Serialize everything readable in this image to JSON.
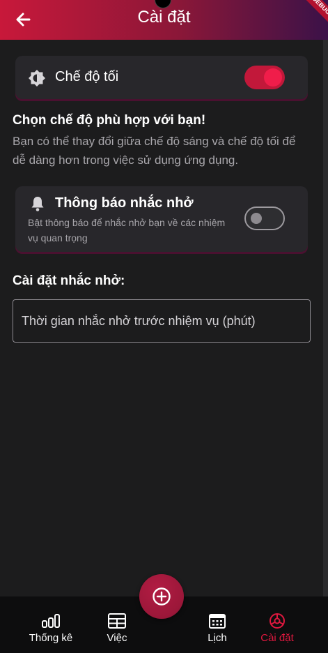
{
  "appbar": {
    "title": "Cài đặt",
    "back_icon": "arrow-left-icon",
    "debug_banner": "DEBUG"
  },
  "dark_mode": {
    "label": "Chế độ tối",
    "icon": "brightness-icon",
    "enabled": true
  },
  "theme_section": {
    "heading": "Chọn chế độ phù hợp với bạn!",
    "description": "Bạn có thể thay đổi giữa chế độ sáng và chế độ tối để dễ dàng hơn trong việc sử dụng ứng dụng."
  },
  "notifications": {
    "title": "Thông báo nhắc nhở",
    "subtitle": "Bật thông báo để nhắc nhở bạn về các nhiệm vụ quan trọng",
    "icon": "bell-icon",
    "enabled": false
  },
  "reminder": {
    "heading": "Cài đặt nhắc nhở:",
    "input_placeholder": "Thời gian nhắc nhở trước nhiệm vụ (phút)",
    "input_value": ""
  },
  "bottom_nav": {
    "items": [
      {
        "label": "Thống kê",
        "icon": "bar-chart-icon"
      },
      {
        "label": "Việc",
        "icon": "table-icon"
      },
      {
        "label": "Lịch",
        "icon": "calendar-icon"
      },
      {
        "label": "Cài đặt",
        "icon": "gear-icon",
        "active": true
      }
    ],
    "fab_icon": "add-circle-icon"
  },
  "colors": {
    "accent": "#e0183f",
    "appbar_start": "#c8183a",
    "appbar_end": "#3b1248",
    "background": "#1c1c1d"
  }
}
